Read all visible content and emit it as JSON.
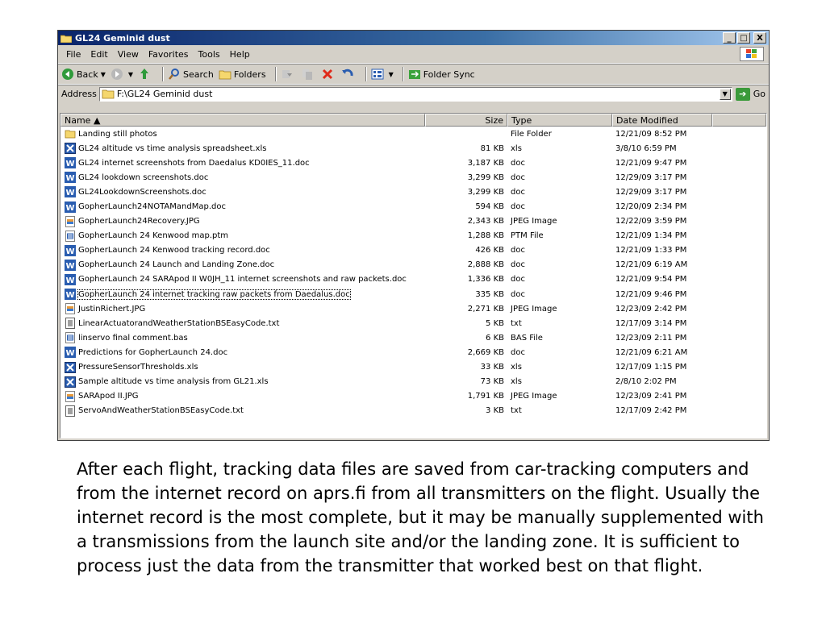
{
  "window": {
    "title": "GL24 Geminid dust",
    "min_label": "_",
    "max_label": "□",
    "close_label": "X"
  },
  "menu": [
    "File",
    "Edit",
    "View",
    "Favorites",
    "Tools",
    "Help"
  ],
  "toolbar": {
    "back": "Back",
    "search": "Search",
    "folders": "Folders",
    "folder_sync": "Folder Sync"
  },
  "address": {
    "label": "Address",
    "value": "F:\\GL24 Geminid dust",
    "go": "Go"
  },
  "columns": {
    "name": "Name ▲",
    "size": "Size",
    "type": "Type",
    "date": "Date Modified"
  },
  "files": [
    {
      "name": "Landing still photos",
      "size": "",
      "type": "File Folder",
      "date": "12/21/09 8:52 PM",
      "icon": "folder-icon"
    },
    {
      "name": "GL24 altitude vs time analysis spreadsheet.xls",
      "size": "81 KB",
      "type": "xls",
      "date": "3/8/10 6:59 PM",
      "icon": "excel-icon"
    },
    {
      "name": "GL24 internet screenshots from Daedalus KD0IES_11.doc",
      "size": "3,187 KB",
      "type": "doc",
      "date": "12/21/09 9:47 PM",
      "icon": "word-icon"
    },
    {
      "name": "GL24 lookdown screenshots.doc",
      "size": "3,299 KB",
      "type": "doc",
      "date": "12/29/09 3:17 PM",
      "icon": "word-icon"
    },
    {
      "name": "GL24LookdownScreenshots.doc",
      "size": "3,299 KB",
      "type": "doc",
      "date": "12/29/09 3:17 PM",
      "icon": "word-icon"
    },
    {
      "name": "GopherLaunch24NOTAMandMap.doc",
      "size": "594 KB",
      "type": "doc",
      "date": "12/20/09 2:34 PM",
      "icon": "word-icon"
    },
    {
      "name": "GopherLaunch24Recovery.JPG",
      "size": "2,343 KB",
      "type": "JPEG Image",
      "date": "12/22/09 3:59 PM",
      "icon": "image-icon"
    },
    {
      "name": "GopherLaunch 24 Kenwood map.ptm",
      "size": "1,288 KB",
      "type": "PTM File",
      "date": "12/21/09 1:34 PM",
      "icon": "generic-file-icon"
    },
    {
      "name": "GopherLaunch 24 Kenwood tracking record.doc",
      "size": "426 KB",
      "type": "doc",
      "date": "12/21/09 1:33 PM",
      "icon": "word-icon"
    },
    {
      "name": "GopherLaunch 24 Launch and Landing Zone.doc",
      "size": "2,888 KB",
      "type": "doc",
      "date": "12/21/09 6:19 AM",
      "icon": "word-icon"
    },
    {
      "name": "GopherLaunch 24 SARApod II W0JH_11 internet screenshots and raw packets.doc",
      "size": "1,336 KB",
      "type": "doc",
      "date": "12/21/09 9:54 PM",
      "icon": "word-icon"
    },
    {
      "name": "GopherLaunch 24 internet tracking raw packets from Daedalus.doc",
      "size": "335 KB",
      "type": "doc",
      "date": "12/21/09 9:46 PM",
      "icon": "word-icon",
      "selected": true
    },
    {
      "name": "JustinRichert.JPG",
      "size": "2,271 KB",
      "type": "JPEG Image",
      "date": "12/23/09 2:42 PM",
      "icon": "image-icon"
    },
    {
      "name": "LinearActuatorandWeatherStationBSEasyCode.txt",
      "size": "5 KB",
      "type": "txt",
      "date": "12/17/09 3:14 PM",
      "icon": "text-file-icon"
    },
    {
      "name": "linservo final comment.bas",
      "size": "6 KB",
      "type": "BAS File",
      "date": "12/23/09 2:11 PM",
      "icon": "generic-file-icon"
    },
    {
      "name": "Predictions for GopherLaunch 24.doc",
      "size": "2,669 KB",
      "type": "doc",
      "date": "12/21/09 6:21 AM",
      "icon": "word-icon"
    },
    {
      "name": "PressureSensorThresholds.xls",
      "size": "33 KB",
      "type": "xls",
      "date": "12/17/09 1:15 PM",
      "icon": "excel-icon"
    },
    {
      "name": "Sample altitude vs time analysis from GL21.xls",
      "size": "73 KB",
      "type": "xls",
      "date": "2/8/10 2:02 PM",
      "icon": "excel-icon"
    },
    {
      "name": "SARApod II.JPG",
      "size": "1,791 KB",
      "type": "JPEG Image",
      "date": "12/23/09 2:41 PM",
      "icon": "image-icon"
    },
    {
      "name": "ServoAndWeatherStationBSEasyCode.txt",
      "size": "3 KB",
      "type": "txt",
      "date": "12/17/09 2:42 PM",
      "icon": "text-file-icon"
    }
  ],
  "caption": "After each flight, tracking data files are saved from car-tracking computers and from the internet record on aprs.fi from all transmitters on the flight.  Usually the internet record is the most complete, but it may be manually supplemented with a transmissions from the launch site and/or the landing zone.  It is sufficient to process just the data from the transmitter that worked best on that flight."
}
